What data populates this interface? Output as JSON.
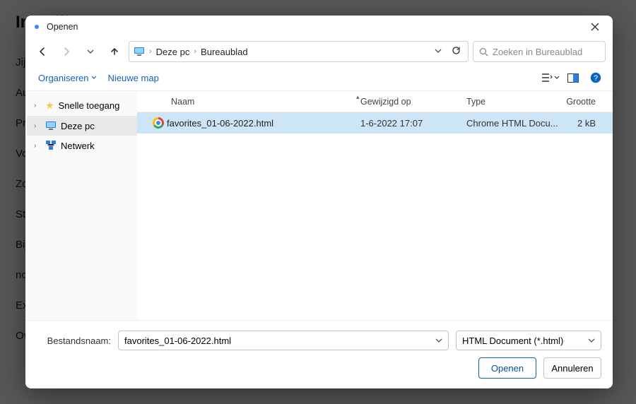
{
  "bg": {
    "title": "Instellin",
    "lines": [
      "Jij en",
      "Auto",
      "Priva",
      "Vorm",
      "Zoek",
      "Stan",
      "Bij o",
      "ncee",
      "Exte",
      "Over"
    ]
  },
  "dialog_title": "Openen",
  "breadcrumb": {
    "root": "Deze pc",
    "leaf": "Bureaublad"
  },
  "search_placeholder": "Zoeken in Bureaublad",
  "toolbar": {
    "organize": "Organiseren",
    "newfolder": "Nieuwe map"
  },
  "tree": {
    "quick": "Snelle toegang",
    "thispc": "Deze pc",
    "network": "Netwerk"
  },
  "columns": {
    "name": "Naam",
    "modified": "Gewijzigd op",
    "type": "Type",
    "size": "Grootte"
  },
  "file": {
    "name": "favorites_01-06-2022.html",
    "modified": "1-6-2022 17:07",
    "type": "Chrome HTML Docu...",
    "size": "2 kB"
  },
  "footer": {
    "filename_label": "Bestandsnaam:",
    "filename_value": "favorites_01-06-2022.html",
    "filter": "HTML Document (*.html)",
    "open": "Openen",
    "cancel": "Annuleren"
  }
}
